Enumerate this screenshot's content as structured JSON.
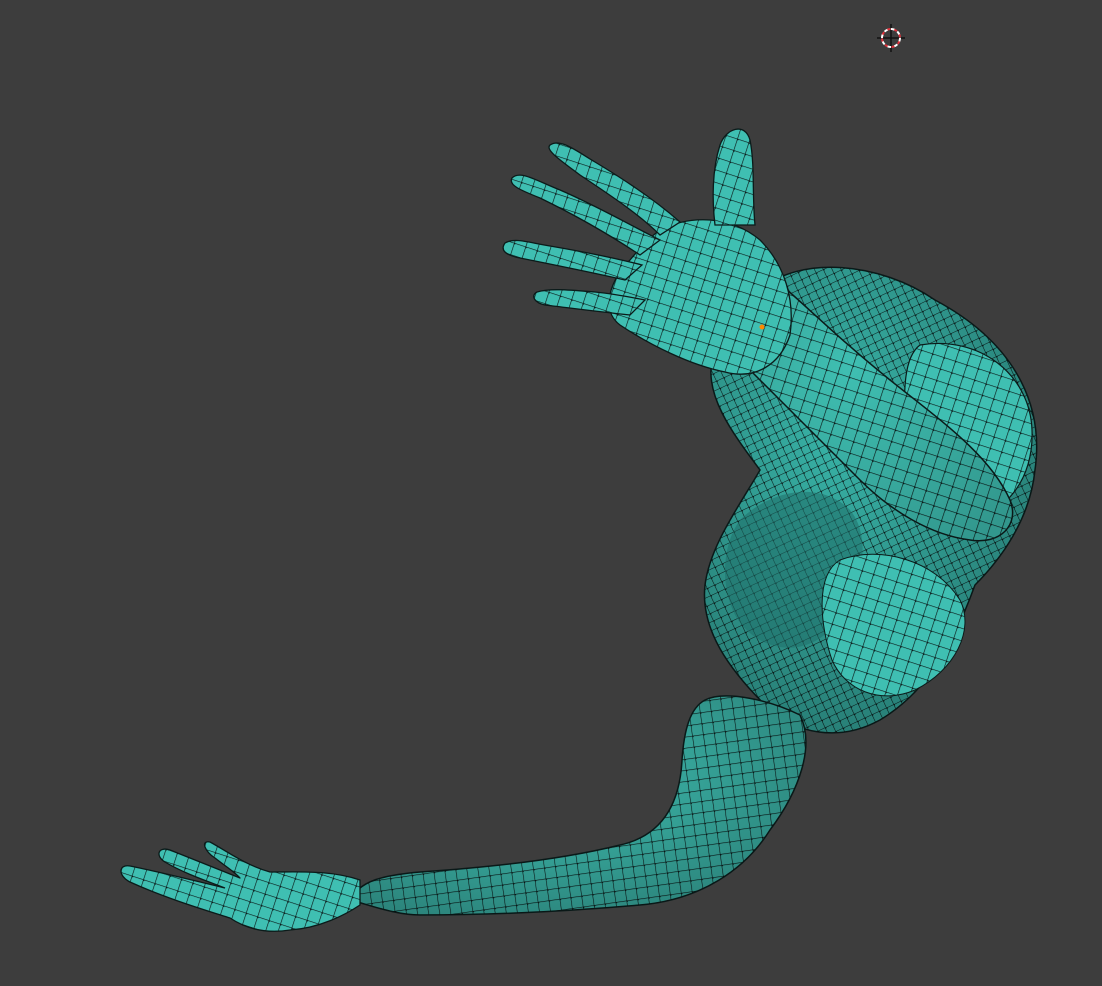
{
  "viewport": {
    "background": "#3d3d3d",
    "mesh_color": "#3fbfb2",
    "mesh_shadow": "#1f6f69",
    "wire_color": "#0b1b1a",
    "active_vertex_color": "#ff8a00",
    "icons": {
      "cursor": "3d-cursor-icon"
    }
  }
}
